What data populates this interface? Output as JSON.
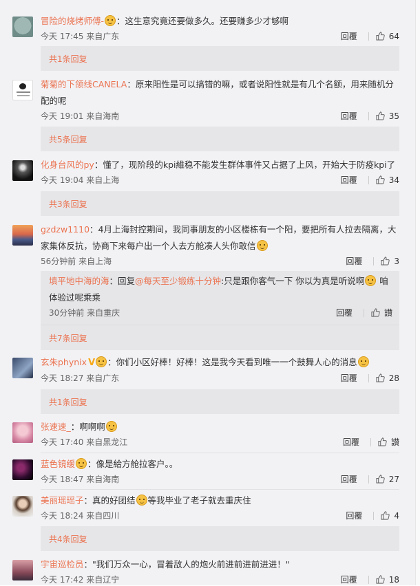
{
  "colors": {
    "username": "#eb7350",
    "background": "#f2f2f5",
    "expand_box": "#e6e6e9"
  },
  "comments": [
    {
      "username": "冒险的烧烤师傅-",
      "badge": "emoji",
      "text": "：这生意究竟还要做多久。还要赚多少才够啊",
      "time": "今天 17:45 来自广东",
      "reply": "回覆",
      "likes": "64",
      "expand": "共1条回复"
    },
    {
      "username": "菊菊的下颌线CANELA",
      "text": "：原来阳性是可以搞错的嘛，或者说阳性就是有几个名额，用来随机分配的呢",
      "time": "今天 19:01 来自海南",
      "reply": "回覆",
      "likes": "35",
      "expand": "共5条回复"
    },
    {
      "username": "化身台风的py",
      "text": "：懂了，现阶段的kpi維稳不能发生群体事件又占据了上风，开始大于防疫kpi了",
      "time": "今天 19:04 来自上海",
      "reply": "回覆",
      "likes": "34",
      "expand": "共3条回复"
    },
    {
      "username": "gzdzw1110",
      "text": "：4月上海封控期间，我同事朋友的小区楼栋有一个阳，要把所有人拉去隔离，大家集体反抗，协商下来每户出一个人去方舱凑人头你敢信",
      "time": "56分钟前 来自上海",
      "reply": "回覆",
      "likes": "3",
      "nested": {
        "username": "填平地中海的海",
        "text_pre": "：回复",
        "mention": "@每天至少锻练十分钟",
        "text_post": ":只是跟你客气一下 你以为真是听说啊",
        "text_tail": " 咱体验过呢乘乘",
        "time": "30分钟前 来自重庆",
        "reply": "回覆",
        "likes": "讃"
      },
      "expand": "共7条回复"
    },
    {
      "username": "玄朱phynix",
      "badge": "V",
      "text": "：你们小区好棒！好棒！这是我今天看到唯一一个鼓舞人心的消息",
      "time": "今天 18:27 来自广东",
      "reply": "回覆",
      "likes": "28",
      "expand": "共1条回复"
    },
    {
      "username": "张速速_",
      "text": "：啊啊啊",
      "time": "今天 17:40 来自黑龙江",
      "reply": "回覆",
      "likes": "讃"
    },
    {
      "username": "蓝色镜缓",
      "badge": "emoji",
      "text": "：像是給方舱拉客户。。",
      "time": "今天 18:47 来自海南",
      "reply": "回覆",
      "likes": "27"
    },
    {
      "username": "美丽瑶瑶子",
      "text": "：真的好团结",
      "text_tail": "等我毕业了老子就去重庆住",
      "time": "今天 18:24 来自四川",
      "reply": "回覆",
      "likes": "4",
      "expand": "共4条回复"
    },
    {
      "username": "宇宙巡检员",
      "text": "：\"我们万众一心，冒着敌人的炮火前进前进前进进！\"",
      "time": "今天 17:42 来自辽宁",
      "reply": "回覆",
      "likes": "18"
    }
  ]
}
